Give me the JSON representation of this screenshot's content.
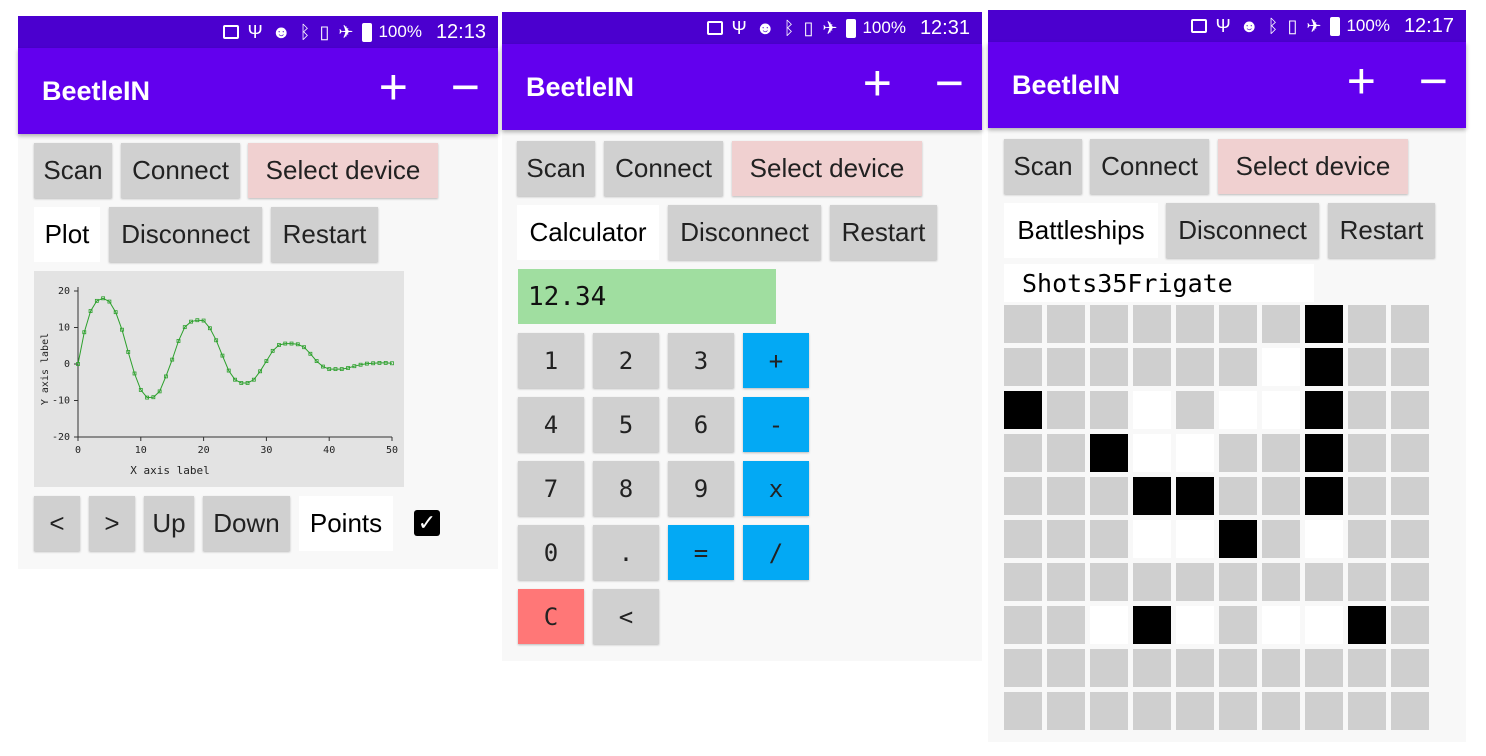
{
  "status_bars": [
    {
      "battery": "100%",
      "time": "12:13"
    },
    {
      "battery": "100%",
      "time": "12:31"
    },
    {
      "battery": "100%",
      "time": "12:17"
    }
  ],
  "app": {
    "title": "BeetleIN",
    "plus": "+",
    "minus": "−"
  },
  "toolbar": {
    "scan": "Scan",
    "connect": "Connect",
    "select_device": "Select device",
    "disconnect": "Disconnect",
    "restart": "Restart"
  },
  "plot_screen": {
    "mode_label": "Plot",
    "nav": {
      "left": "<",
      "right": ">",
      "up": "Up",
      "down": "Down"
    },
    "points_label": "Points",
    "points_checked": true
  },
  "chart_data": {
    "type": "line",
    "title": "",
    "xlabel": "X axis label",
    "ylabel": "Y axis label",
    "xlim": [
      0,
      50
    ],
    "ylim": [
      -20,
      20
    ],
    "x_ticks": [
      "0",
      "10",
      "20",
      "30",
      "40",
      "50"
    ],
    "y_ticks": [
      "20",
      "10",
      "0",
      "-10",
      "-20"
    ],
    "series_color": "#2ca02c",
    "x": [
      0,
      1,
      2,
      3,
      4,
      5,
      6,
      7,
      8,
      9,
      10,
      11,
      12,
      13,
      14,
      15,
      16,
      17,
      18,
      19,
      20,
      21,
      22,
      23,
      24,
      25,
      26,
      27,
      28,
      29,
      30,
      31,
      32,
      33,
      34,
      35,
      36,
      37,
      38,
      39,
      40,
      41,
      42,
      43,
      44,
      45,
      46,
      47,
      48,
      49,
      50
    ],
    "values": [
      0,
      8.7,
      14.5,
      17.3,
      18,
      17.1,
      14.2,
      9.4,
      3.3,
      -2.6,
      -7.1,
      -9.2,
      -9.1,
      -7.5,
      -3.4,
      1.2,
      6.3,
      10.1,
      11.6,
      12,
      11.9,
      9.8,
      6.5,
      2.3,
      -1.8,
      -4.3,
      -5.2,
      -5.2,
      -4.3,
      -2,
      0.8,
      3.6,
      5.2,
      5.6,
      5.6,
      5.4,
      4.6,
      2.8,
      0.8,
      -0.7,
      -1.4,
      -1.4,
      -1.4,
      -1.1,
      -0.6,
      -0.2,
      0.1,
      0.2,
      0.3,
      0.3,
      0.2
    ]
  },
  "calc_screen": {
    "mode_label": "Calculator",
    "display": "12.34",
    "keys": [
      "1",
      "2",
      "3",
      "+",
      "4",
      "5",
      "6",
      "-",
      "7",
      "8",
      "9",
      "x",
      "0",
      ".",
      "=",
      "/",
      "C",
      "<"
    ]
  },
  "battleship_screen": {
    "mode_label": "Battleships",
    "shots_label": "Shots",
    "shots": "35",
    "ship": "Frigate",
    "grid": [
      "uuuuuuubuu",
      "uuuuuuwbuu",
      "buuwuwwbuu",
      "uubwwuubuu",
      "uuubbuubuu",
      "uuuwwbuwuu",
      "uuuuuuuuuu",
      "uuwbwuwwbu",
      "uuuuuuuuuu",
      "uuuuuuuuuu"
    ]
  }
}
